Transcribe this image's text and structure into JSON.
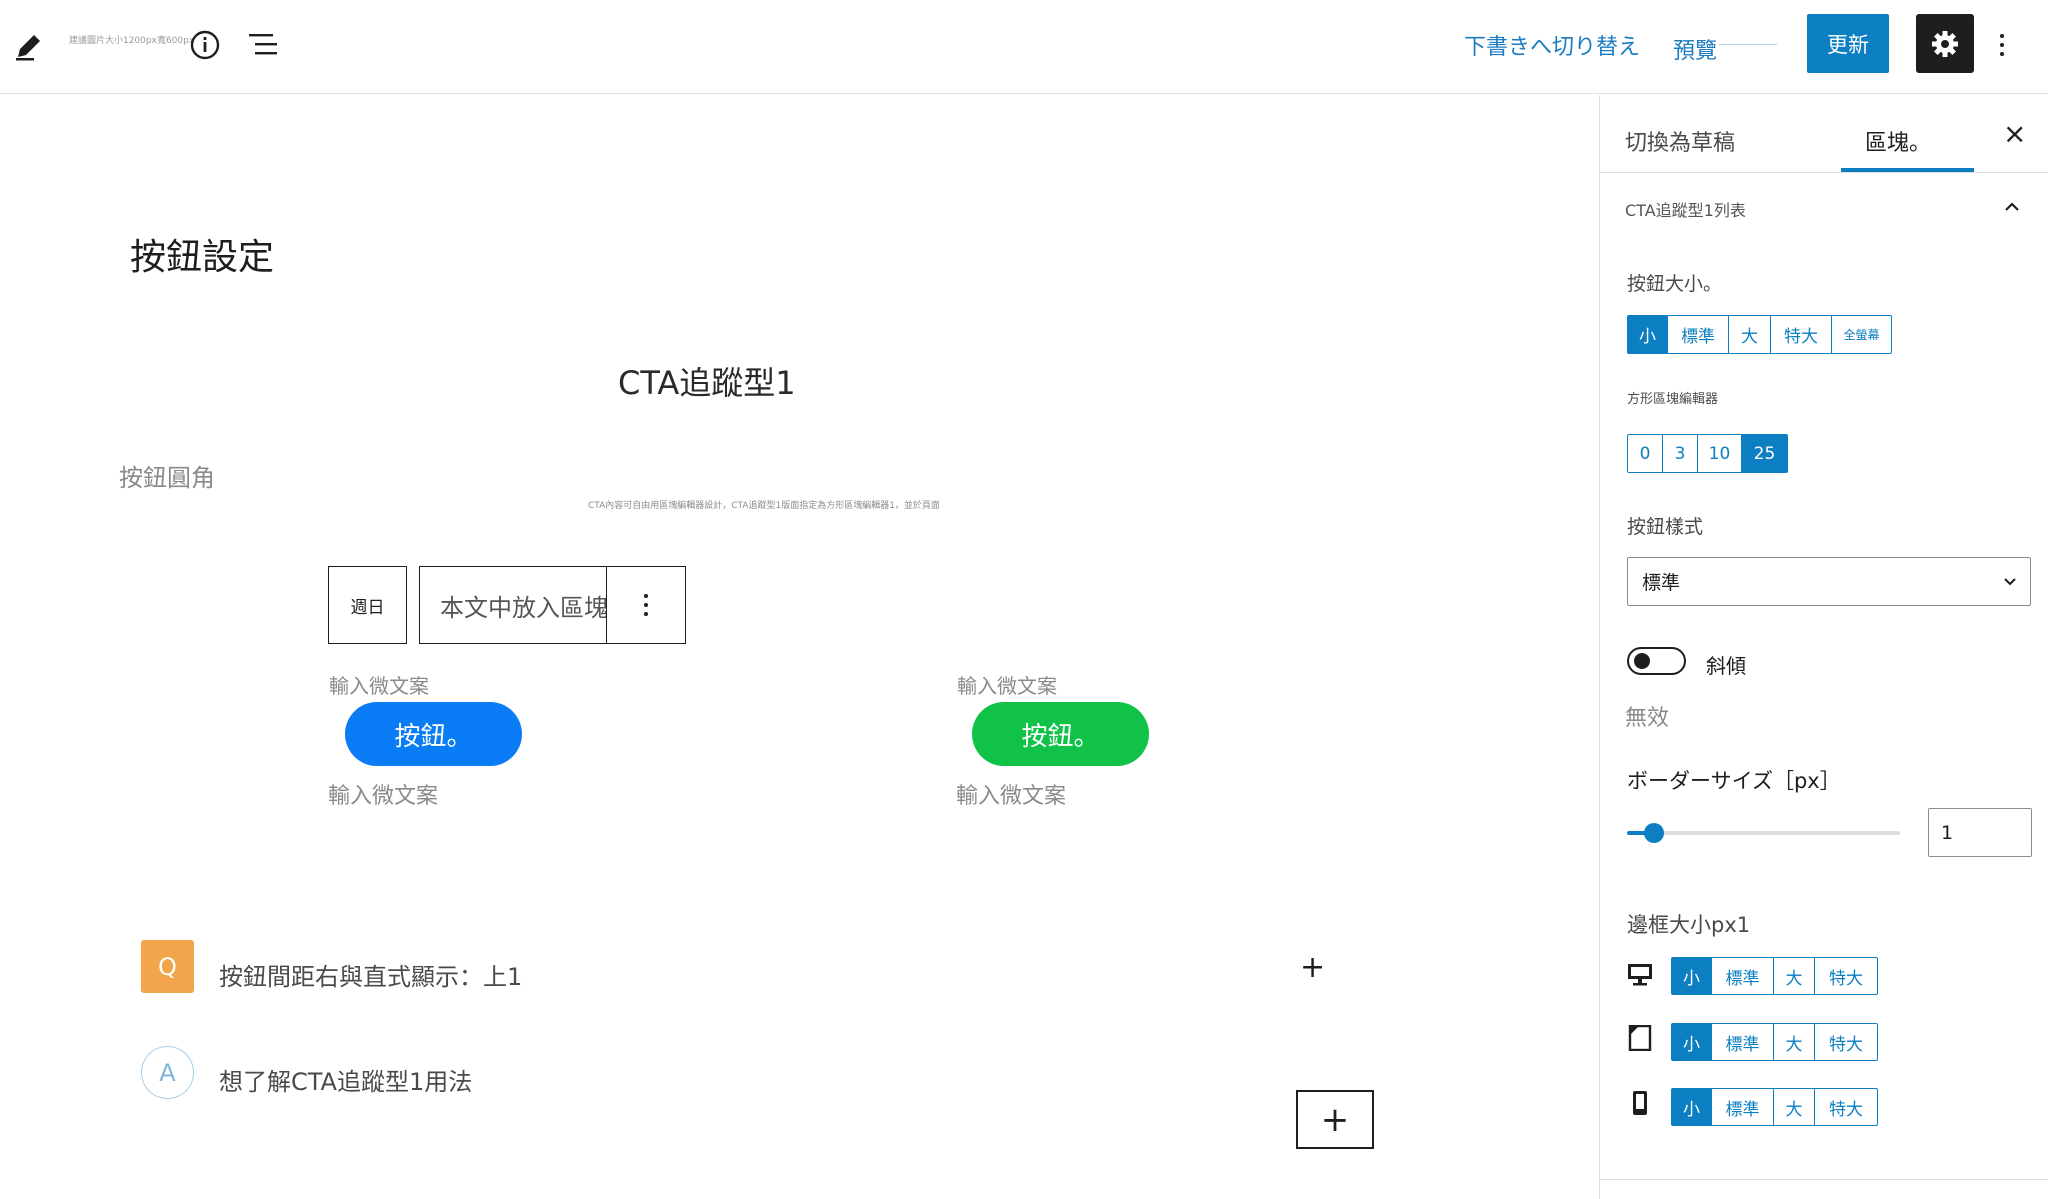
{
  "topbar": {
    "tiny_note": "建議圖片大小1200px寬600px",
    "switch_draft": "下書きへ切り替え",
    "preview": "預覽",
    "update": "更新"
  },
  "canvas": {
    "page_title": "按鈕設定",
    "cta_title": "CTA追蹤型1",
    "corner_label": "按鈕圓角",
    "description": "CTA內容可自由用區塊編輯器設計，CTA追蹤型1版面指定為方形區塊編輯器1，並於頁面",
    "toolbar": {
      "day": "週日",
      "placeholder": "本文中放入區塊"
    },
    "buttons": [
      {
        "micro_top": "輸入微文案",
        "label": "按鈕。",
        "micro_bottom": "輸入微文案",
        "color": "#0a7cf5"
      },
      {
        "micro_top": "輸入微文案",
        "label": "按鈕。",
        "micro_bottom": "輸入微文案",
        "color": "#10c248"
      }
    ],
    "faq": {
      "q_badge": "Q",
      "question": "按鈕間距右與直式顯示：上1",
      "a_badge": "A",
      "answer": "想了解CTA追蹤型1用法",
      "plus_small": "+",
      "plus_box": "+"
    }
  },
  "sidebar": {
    "tab_draft": "切換為草稿",
    "tab_block": "區塊。",
    "close": "×",
    "panel_title": "CTA追蹤型1列表",
    "button_size": {
      "label": "按鈕大小。",
      "options": [
        "小",
        "標準",
        "大",
        "特大",
        "全螢幕"
      ],
      "selected": 0
    },
    "square_label": "方形區塊編輯器",
    "radius": {
      "options": [
        "0",
        "3",
        "10",
        "25"
      ],
      "selected": 3
    },
    "style": {
      "label": "按鈕樣式",
      "value": "標準"
    },
    "italic": {
      "label": "斜傾",
      "status": "無效"
    },
    "border": {
      "label": "ボーダーサイズ［px］",
      "value": "1",
      "slider_fraction": 0.1
    },
    "margin": {
      "label": "邊框大小px1",
      "options": [
        "小",
        "標準",
        "大",
        "特大"
      ],
      "devices": [
        "desktop-icon",
        "tablet-icon",
        "mobile-icon"
      ],
      "selected": 0
    },
    "accent": "#0b7fc2"
  }
}
